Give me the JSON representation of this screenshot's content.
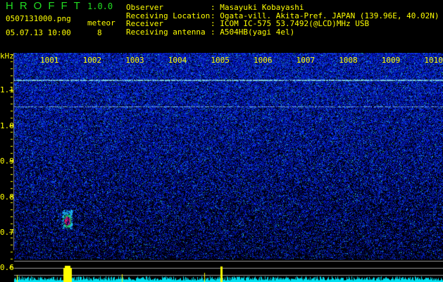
{
  "header": {
    "app_title": "HROFFT",
    "version": "1.0.0",
    "filename": "0507131000.png",
    "datetime": "05.07.13 10:00",
    "meteor_label": "meteor",
    "meteor_count": "8"
  },
  "info": [
    {
      "label": "Observer",
      "value": "Masayuki Kobayashi"
    },
    {
      "label": "Receiving Location",
      "value": "Ogata-vill. Akita-Pref. JAPAN (139.96E, 40.02N)"
    },
    {
      "label": "Receiver",
      "value": "ICOM IC-575 53.7492(@LCD)MHz USB"
    },
    {
      "label": "Receiving antenna",
      "value": "A504HB(yagi 4el)"
    }
  ],
  "spectrogram": {
    "y_unit": "kHz",
    "y_ticks": [
      "1.1",
      "1.0",
      "0.9",
      "0.8",
      "0.7",
      "0.6"
    ],
    "time_labels": [
      "1001",
      "1002",
      "1003",
      "1004",
      "1005",
      "1006",
      "1007",
      "1008",
      "1009",
      "1010"
    ],
    "colors": {
      "background": "#000010",
      "noise": "#1a2ad0",
      "text": "#ffff00",
      "title": "#22dd22",
      "histogram": "#00e0f0",
      "meteor_peak": "#ffff00"
    }
  }
}
